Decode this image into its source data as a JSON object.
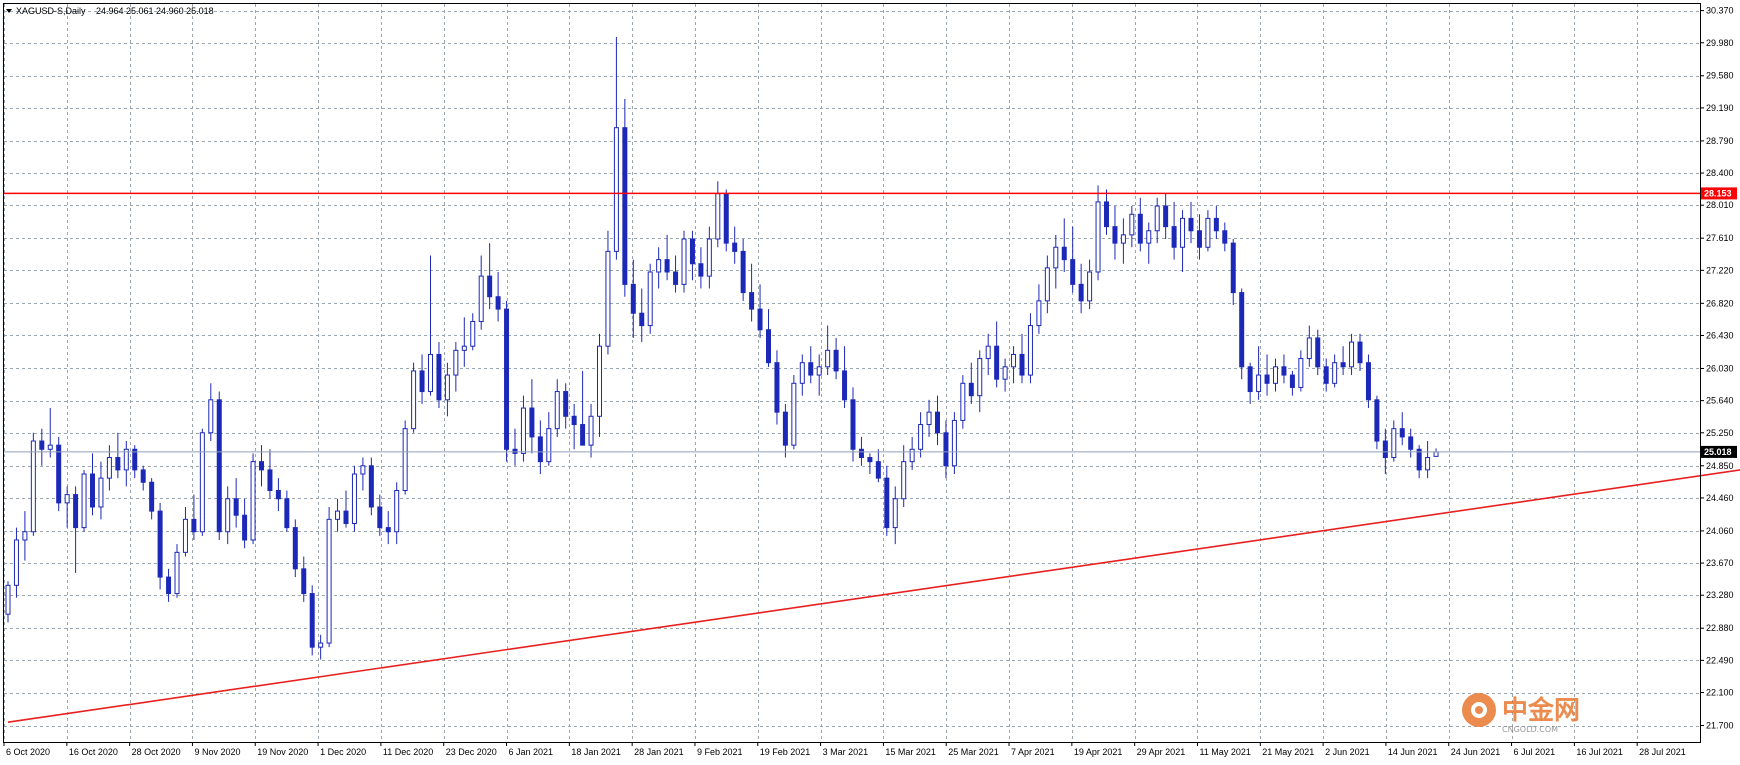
{
  "header": {
    "symbol": "XAGUSD-S,Daily",
    "ohlc": "24.964 25.061 24.960 25.018"
  },
  "colors": {
    "background": "#ffffff",
    "grid": "#9aa6b0",
    "candle": "#1c28b8",
    "price_line": "#8f9fb8",
    "resistance": "#ff0000",
    "support_trend": "#e8201e",
    "price_tag_bg": "#000000",
    "resistance_tag_bg": "#ff0000",
    "watermark_orange": "#e8772e"
  },
  "watermark": {
    "name": "中金网",
    "url": "CNGOLD.COM"
  },
  "chart_data": {
    "type": "candlestick",
    "title": "",
    "xlabel": "",
    "ylabel": "",
    "ylim": [
      21.5,
      30.45
    ],
    "y_ticks": [
      "30.370",
      "29.980",
      "29.580",
      "29.190",
      "28.790",
      "28.400",
      "28.010",
      "27.610",
      "27.220",
      "26.820",
      "26.430",
      "26.030",
      "25.640",
      "25.250",
      "24.850",
      "24.460",
      "24.060",
      "23.670",
      "23.280",
      "22.880",
      "22.490",
      "22.100",
      "21.700"
    ],
    "x_ticks": [
      "6 Oct 2020",
      "16 Oct 2020",
      "28 Oct 2020",
      "9 Nov 2020",
      "19 Nov 2020",
      "1 Dec 2020",
      "11 Dec 2020",
      "23 Dec 2020",
      "6 Jan 2021",
      "18 Jan 2021",
      "28 Jan 2021",
      "9 Feb 2021",
      "19 Feb 2021",
      "3 Mar 2021",
      "15 Mar 2021",
      "25 Mar 2021",
      "7 Apr 2021",
      "19 Apr 2021",
      "29 Apr 2021",
      "11 May 2021",
      "21 May 2021",
      "2 Jun 2021",
      "14 Jun 2021",
      "24 Jun 2021",
      "6 Jul 2021",
      "16 Jul 2021",
      "28 Jul 2021"
    ],
    "grid": true,
    "current_price": 25.018,
    "current_price_label": "25.018",
    "resistance": {
      "value": 28.153,
      "label": "28.153"
    },
    "trendline": {
      "from": {
        "bar": 0,
        "price": 21.74
      },
      "to": {
        "bar": 260,
        "price": 25.62
      }
    },
    "candles": [
      [
        23.05,
        23.45,
        22.95,
        23.4
      ],
      [
        23.4,
        24.1,
        23.25,
        23.95
      ],
      [
        23.95,
        24.3,
        23.7,
        24.05
      ],
      [
        24.05,
        25.25,
        24.0,
        25.15
      ],
      [
        25.15,
        25.3,
        24.85,
        25.05
      ],
      [
        25.05,
        25.55,
        24.95,
        25.1
      ],
      [
        25.1,
        25.2,
        24.3,
        24.4
      ],
      [
        24.4,
        24.6,
        24.1,
        24.5
      ],
      [
        24.5,
        24.6,
        23.55,
        24.1
      ],
      [
        24.1,
        24.8,
        24.05,
        24.75
      ],
      [
        24.75,
        25.0,
        24.25,
        24.35
      ],
      [
        24.35,
        24.9,
        24.2,
        24.7
      ],
      [
        24.7,
        25.1,
        24.55,
        24.95
      ],
      [
        24.95,
        25.25,
        24.7,
        24.8
      ],
      [
        24.8,
        25.15,
        24.6,
        25.05
      ],
      [
        25.05,
        25.1,
        24.7,
        24.8
      ],
      [
        24.8,
        24.85,
        24.55,
        24.65
      ],
      [
        24.65,
        24.7,
        24.2,
        24.3
      ],
      [
        24.3,
        24.4,
        23.35,
        23.5
      ],
      [
        23.5,
        23.6,
        23.2,
        23.3
      ],
      [
        23.3,
        23.9,
        23.25,
        23.8
      ],
      [
        23.8,
        24.35,
        23.75,
        24.2
      ],
      [
        24.2,
        24.5,
        23.95,
        24.05
      ],
      [
        24.05,
        25.3,
        24.0,
        25.25
      ],
      [
        25.25,
        25.85,
        25.15,
        25.65
      ],
      [
        25.65,
        25.75,
        23.95,
        24.05
      ],
      [
        24.05,
        24.6,
        23.9,
        24.45
      ],
      [
        24.45,
        24.7,
        24.1,
        24.25
      ],
      [
        24.25,
        24.45,
        23.85,
        23.95
      ],
      [
        23.95,
        25.0,
        23.9,
        24.9
      ],
      [
        24.9,
        25.1,
        24.6,
        24.8
      ],
      [
        24.8,
        25.05,
        24.45,
        24.55
      ],
      [
        24.55,
        24.7,
        24.3,
        24.45
      ],
      [
        24.45,
        24.55,
        24.05,
        24.1
      ],
      [
        24.1,
        24.2,
        23.5,
        23.6
      ],
      [
        23.6,
        23.75,
        23.2,
        23.3
      ],
      [
        23.3,
        23.4,
        22.55,
        22.65
      ],
      [
        22.65,
        22.8,
        22.5,
        22.7
      ],
      [
        22.7,
        24.35,
        22.65,
        24.2
      ],
      [
        24.2,
        24.45,
        24.05,
        24.3
      ],
      [
        24.3,
        24.55,
        24.1,
        24.15
      ],
      [
        24.15,
        24.85,
        24.05,
        24.75
      ],
      [
        24.75,
        24.95,
        24.55,
        24.85
      ],
      [
        24.85,
        24.95,
        24.25,
        24.35
      ],
      [
        24.35,
        24.5,
        24.0,
        24.1
      ],
      [
        24.1,
        24.3,
        23.9,
        24.05
      ],
      [
        24.05,
        24.65,
        23.9,
        24.55
      ],
      [
        24.55,
        25.4,
        24.5,
        25.3
      ],
      [
        25.3,
        26.1,
        25.25,
        26.0
      ],
      [
        26.0,
        26.2,
        25.6,
        25.75
      ],
      [
        25.75,
        27.4,
        25.7,
        26.2
      ],
      [
        26.2,
        26.35,
        25.55,
        25.65
      ],
      [
        25.65,
        26.1,
        25.45,
        25.95
      ],
      [
        25.95,
        26.35,
        25.75,
        26.25
      ],
      [
        26.25,
        26.65,
        26.05,
        26.3
      ],
      [
        26.3,
        26.7,
        26.25,
        26.6
      ],
      [
        26.6,
        27.4,
        26.5,
        27.15
      ],
      [
        27.15,
        27.55,
        26.75,
        26.9
      ],
      [
        26.9,
        27.2,
        26.6,
        26.75
      ],
      [
        26.75,
        26.85,
        24.9,
        25.05
      ],
      [
        25.05,
        25.3,
        24.85,
        25.0
      ],
      [
        25.0,
        25.7,
        24.9,
        25.55
      ],
      [
        25.55,
        25.9,
        25.0,
        25.2
      ],
      [
        25.2,
        25.4,
        24.75,
        24.9
      ],
      [
        24.9,
        25.5,
        24.85,
        25.3
      ],
      [
        25.3,
        25.9,
        25.2,
        25.75
      ],
      [
        25.75,
        25.85,
        25.3,
        25.45
      ],
      [
        25.45,
        25.6,
        25.05,
        25.35
      ],
      [
        25.35,
        26.0,
        25.25,
        25.1
      ],
      [
        25.1,
        25.6,
        24.95,
        25.45
      ],
      [
        25.45,
        26.45,
        25.2,
        26.3
      ],
      [
        26.3,
        27.7,
        26.2,
        27.45
      ],
      [
        27.45,
        30.05,
        27.35,
        28.95
      ],
      [
        28.95,
        29.3,
        26.9,
        27.05
      ],
      [
        27.05,
        27.35,
        26.4,
        26.7
      ],
      [
        26.7,
        27.0,
        26.35,
        26.55
      ],
      [
        26.55,
        27.3,
        26.45,
        27.2
      ],
      [
        27.2,
        27.5,
        27.0,
        27.35
      ],
      [
        27.35,
        27.65,
        27.1,
        27.2
      ],
      [
        27.2,
        27.4,
        26.95,
        27.05
      ],
      [
        27.05,
        27.7,
        26.95,
        27.6
      ],
      [
        27.6,
        27.7,
        27.1,
        27.3
      ],
      [
        27.3,
        27.5,
        27.0,
        27.15
      ],
      [
        27.15,
        27.75,
        27.0,
        27.6
      ],
      [
        27.6,
        28.3,
        27.5,
        28.15
      ],
      [
        28.15,
        28.2,
        27.45,
        27.55
      ],
      [
        27.55,
        27.75,
        27.3,
        27.45
      ],
      [
        27.45,
        27.6,
        26.85,
        26.95
      ],
      [
        26.95,
        27.3,
        26.6,
        26.75
      ],
      [
        26.75,
        27.05,
        26.4,
        26.5
      ],
      [
        26.5,
        26.75,
        26.05,
        26.1
      ],
      [
        26.1,
        26.25,
        25.35,
        25.5
      ],
      [
        25.5,
        25.6,
        24.95,
        25.1
      ],
      [
        25.1,
        25.95,
        25.05,
        25.85
      ],
      [
        25.85,
        26.2,
        25.7,
        26.1
      ],
      [
        26.1,
        26.3,
        25.85,
        25.95
      ],
      [
        25.95,
        26.2,
        25.7,
        26.05
      ],
      [
        26.05,
        26.55,
        25.95,
        26.25
      ],
      [
        26.25,
        26.4,
        25.9,
        26.0
      ],
      [
        26.0,
        26.3,
        25.55,
        25.65
      ],
      [
        25.65,
        25.8,
        24.9,
        25.05
      ],
      [
        25.05,
        25.2,
        24.85,
        24.95
      ],
      [
        24.95,
        25.0,
        24.75,
        24.9
      ],
      [
        24.9,
        25.05,
        24.65,
        24.7
      ],
      [
        24.7,
        24.85,
        24.0,
        24.1
      ],
      [
        24.1,
        24.6,
        23.9,
        24.45
      ],
      [
        24.45,
        25.1,
        24.35,
        24.9
      ],
      [
        24.9,
        25.2,
        24.8,
        25.05
      ],
      [
        25.05,
        25.5,
        24.95,
        25.35
      ],
      [
        25.35,
        25.65,
        25.2,
        25.5
      ],
      [
        25.5,
        25.7,
        25.1,
        25.25
      ],
      [
        25.25,
        25.4,
        24.7,
        24.85
      ],
      [
        24.85,
        25.5,
        24.75,
        25.4
      ],
      [
        25.4,
        25.95,
        25.3,
        25.85
      ],
      [
        25.85,
        26.1,
        25.6,
        25.7
      ],
      [
        25.7,
        26.25,
        25.5,
        26.15
      ],
      [
        26.15,
        26.45,
        25.95,
        26.3
      ],
      [
        26.3,
        26.6,
        25.8,
        25.9
      ],
      [
        25.9,
        26.15,
        25.75,
        26.05
      ],
      [
        26.05,
        26.3,
        25.85,
        26.2
      ],
      [
        26.2,
        26.45,
        25.85,
        25.95
      ],
      [
        25.95,
        26.7,
        25.85,
        26.55
      ],
      [
        26.55,
        27.05,
        26.45,
        26.85
      ],
      [
        26.85,
        27.4,
        26.7,
        27.25
      ],
      [
        27.25,
        27.65,
        27.0,
        27.5
      ],
      [
        27.5,
        27.85,
        27.2,
        27.35
      ],
      [
        27.35,
        27.75,
        26.95,
        27.05
      ],
      [
        27.05,
        27.3,
        26.7,
        26.85
      ],
      [
        26.85,
        27.35,
        26.75,
        27.2
      ],
      [
        27.2,
        28.25,
        27.1,
        28.05
      ],
      [
        28.05,
        28.2,
        27.65,
        27.75
      ],
      [
        27.75,
        28.0,
        27.35,
        27.55
      ],
      [
        27.55,
        27.85,
        27.3,
        27.65
      ],
      [
        27.65,
        28.0,
        27.5,
        27.9
      ],
      [
        27.9,
        28.1,
        27.45,
        27.55
      ],
      [
        27.55,
        27.8,
        27.3,
        27.7
      ],
      [
        27.7,
        28.1,
        27.55,
        28.0
      ],
      [
        28.0,
        28.15,
        27.6,
        27.75
      ],
      [
        27.75,
        28.05,
        27.35,
        27.5
      ],
      [
        27.5,
        27.95,
        27.2,
        27.85
      ],
      [
        27.85,
        28.05,
        27.55,
        27.7
      ],
      [
        27.7,
        27.9,
        27.35,
        27.5
      ],
      [
        27.5,
        27.95,
        27.45,
        27.85
      ],
      [
        27.85,
        28.0,
        27.6,
        27.7
      ],
      [
        27.7,
        27.8,
        27.45,
        27.55
      ],
      [
        27.55,
        27.6,
        26.8,
        26.95
      ],
      [
        26.95,
        27.0,
        25.9,
        26.05
      ],
      [
        26.05,
        26.1,
        25.6,
        25.75
      ],
      [
        25.75,
        26.3,
        25.65,
        25.95
      ],
      [
        25.95,
        26.2,
        25.7,
        25.85
      ],
      [
        25.85,
        26.15,
        25.75,
        26.05
      ],
      [
        26.05,
        26.2,
        25.85,
        25.95
      ],
      [
        25.95,
        26.0,
        25.7,
        25.8
      ],
      [
        25.8,
        26.25,
        25.75,
        26.15
      ],
      [
        26.15,
        26.55,
        26.05,
        26.4
      ],
      [
        26.4,
        26.5,
        25.95,
        26.05
      ],
      [
        26.05,
        26.15,
        25.75,
        25.85
      ],
      [
        25.85,
        26.2,
        25.8,
        26.1
      ],
      [
        26.1,
        26.3,
        25.95,
        26.05
      ],
      [
        26.05,
        26.45,
        25.95,
        26.35
      ],
      [
        26.35,
        26.45,
        26.0,
        26.1
      ],
      [
        26.1,
        26.2,
        25.55,
        25.65
      ],
      [
        25.65,
        25.7,
        25.05,
        25.15
      ],
      [
        25.15,
        25.3,
        24.75,
        24.95
      ],
      [
        24.95,
        25.4,
        24.9,
        25.3
      ],
      [
        25.3,
        25.5,
        25.1,
        25.2
      ],
      [
        25.2,
        25.3,
        24.95,
        25.05
      ],
      [
        25.05,
        25.1,
        24.7,
        24.8
      ],
      [
        24.8,
        25.15,
        24.7,
        24.95
      ],
      [
        24.964,
        25.061,
        24.96,
        25.018
      ]
    ]
  }
}
